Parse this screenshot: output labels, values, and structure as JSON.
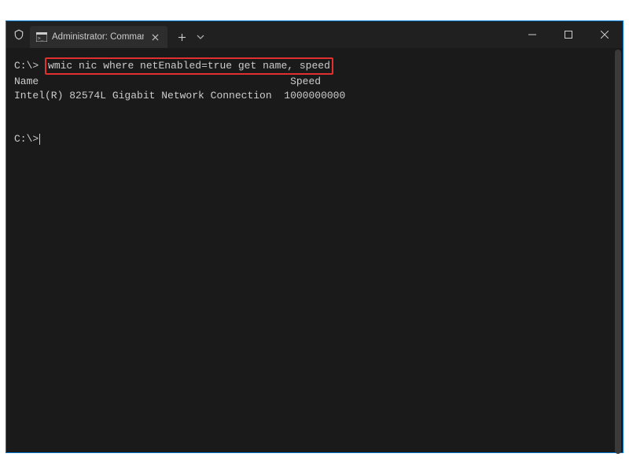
{
  "tab": {
    "title": "Administrator: Command Pron"
  },
  "terminal": {
    "prompt1": "C:\\>",
    "command": "wmic nic where netEnabled=true get name, speed",
    "header_name": "Name",
    "header_speed": "Speed",
    "row_name": "Intel(R) 82574L Gigabit Network Connection",
    "row_speed": "1000000000",
    "prompt2": "C:\\>"
  }
}
